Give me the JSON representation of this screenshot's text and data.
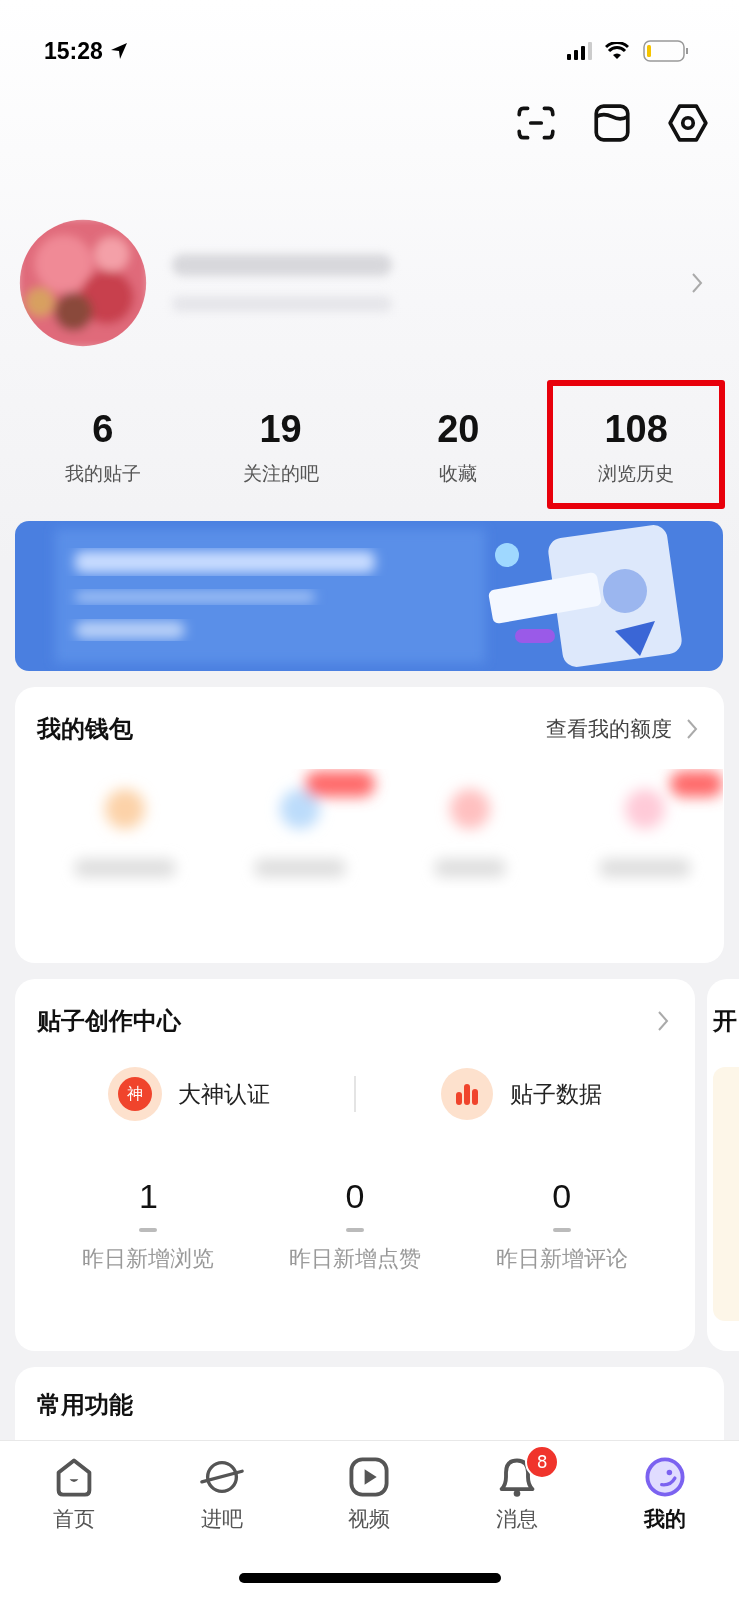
{
  "status_bar": {
    "time": "15:28"
  },
  "stats": [
    {
      "value": "6",
      "label": "我的贴子",
      "highlighted": false
    },
    {
      "value": "19",
      "label": "关注的吧",
      "highlighted": false
    },
    {
      "value": "20",
      "label": "收藏",
      "highlighted": false
    },
    {
      "value": "108",
      "label": "浏览历史",
      "highlighted": true
    }
  ],
  "wallet": {
    "title": "我的钱包",
    "link": "查看我的额度"
  },
  "creation_center": {
    "title": "贴子创作中心",
    "shortcuts": [
      {
        "kind": "badge",
        "label": "大神认证",
        "icon_text": "神"
      },
      {
        "kind": "chart",
        "label": "贴子数据"
      }
    ],
    "metrics": [
      {
        "value": "1",
        "label": "昨日新增浏览"
      },
      {
        "value": "0",
        "label": "昨日新增点赞"
      },
      {
        "value": "0",
        "label": "昨日新增评论"
      }
    ]
  },
  "side_card": {
    "title": "开"
  },
  "common_functions": {
    "title": "常用功能"
  },
  "tab_bar": [
    {
      "kind": "home",
      "label": "首页",
      "selected": false
    },
    {
      "kind": "planet",
      "label": "进吧",
      "selected": false
    },
    {
      "kind": "video",
      "label": "视频",
      "selected": false
    },
    {
      "kind": "bell",
      "label": "消息",
      "selected": false,
      "badge": "8"
    },
    {
      "kind": "face",
      "label": "我的",
      "selected": true
    }
  ]
}
